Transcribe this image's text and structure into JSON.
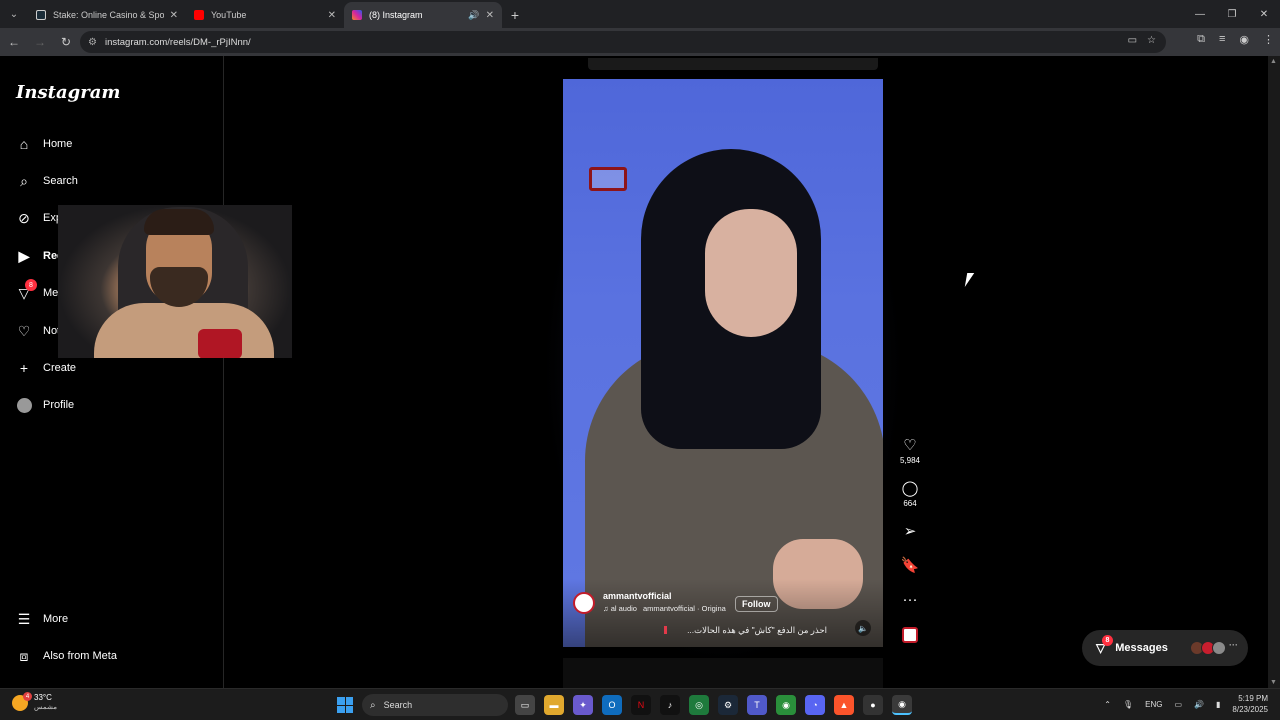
{
  "browser": {
    "tabs": [
      {
        "title": "Stake: Online Casino & Sports I",
        "favicon_color": "#1a2c38",
        "active": false
      },
      {
        "title": "YouTube",
        "favicon_color": "#ff0000",
        "active": false
      },
      {
        "title": "(8) Instagram",
        "favicon_color": "#d6249f",
        "active": true
      }
    ],
    "url": "instagram.com/reels/DM-_rPjINnn/"
  },
  "instagram": {
    "logo": "Instagram",
    "nav": [
      {
        "label": "Home",
        "icon": "home-icon"
      },
      {
        "label": "Search",
        "icon": "search-icon"
      },
      {
        "label": "Explore",
        "icon": "compass-icon"
      },
      {
        "label": "Reels",
        "icon": "reels-icon"
      },
      {
        "label": "Messages",
        "icon": "messenger-icon",
        "badge": "8"
      },
      {
        "label": "Notifications",
        "icon": "heart-icon"
      },
      {
        "label": "Create",
        "icon": "plus-icon"
      },
      {
        "label": "Profile",
        "icon": "profile-icon"
      }
    ],
    "more_label": "More",
    "meta_label": "Also from Meta"
  },
  "reel": {
    "username": "ammantvofficial",
    "follow_label": "Follow",
    "audio_prefix": "♫ al audio",
    "audio_text": "ammantvofficial · Origina",
    "caption": "احذر من الدفع \"كاش\" في هذه الحالات...",
    "likes": "5,984",
    "comments": "664"
  },
  "messages_pill": {
    "label": "Messages",
    "badge": "8",
    "avatar_colors": [
      "#6b3a2a",
      "#c81e2e",
      "#8a8a8a"
    ]
  },
  "taskbar": {
    "temperature": "33°C",
    "weather_text": "مشمس",
    "weather_badge": "4",
    "search_label": "Search",
    "language": "ENG",
    "time": "5:19 PM",
    "date": "8/23/2025"
  }
}
